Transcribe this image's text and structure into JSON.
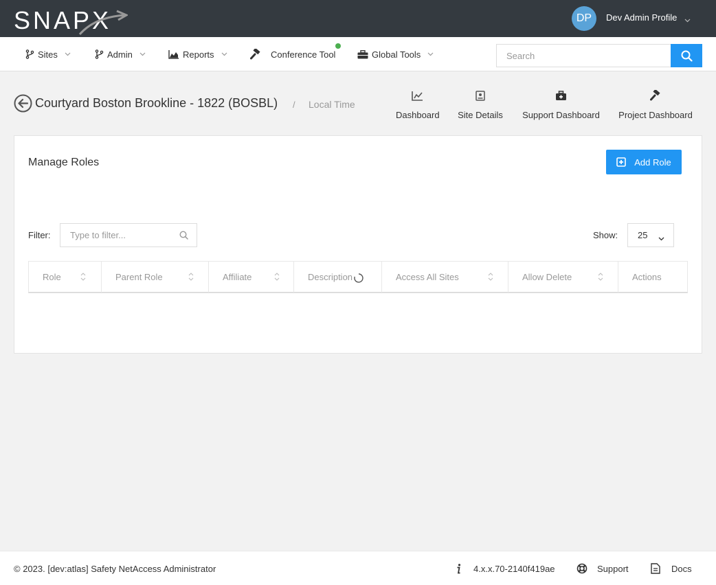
{
  "topbar": {
    "logo_text": "SNAPX",
    "avatar_initials": "DP",
    "profile_name": "Dev Admin Profile"
  },
  "nav": {
    "items": [
      {
        "label": "Sites",
        "icon": "branch-icon"
      },
      {
        "label": "Admin",
        "icon": "branch-icon"
      },
      {
        "label": "Reports",
        "icon": "area-chart-icon"
      },
      {
        "label": "Conference Tool",
        "icon": "gavel-icon"
      },
      {
        "label": "Global Tools",
        "icon": "toolbox-icon"
      }
    ],
    "search_placeholder": "Search"
  },
  "header": {
    "site_title": "Courtyard Boston Brookline - 1822 (BOSBL)",
    "separator": "/",
    "local_time": "Local Time",
    "links": [
      {
        "label": "Dashboard",
        "icon": "line-chart-icon"
      },
      {
        "label": "Site Details",
        "icon": "address-card-icon"
      },
      {
        "label": "Support Dashboard",
        "icon": "medkit-icon"
      },
      {
        "label": "Project Dashboard",
        "icon": "gavel-icon"
      }
    ]
  },
  "card": {
    "title": "Manage Roles",
    "add_button": "Add Role",
    "filter_label": "Filter:",
    "filter_placeholder": "Type to filter...",
    "show_label": "Show:",
    "show_value": "25",
    "columns": [
      "Role",
      "Parent Role",
      "Affiliate",
      "Description",
      "Access All Sites",
      "Allow Delete",
      "Actions"
    ]
  },
  "footer": {
    "copyright": "© 2023. [dev:atlas] Safety NetAccess Administrator",
    "version": "4.x.x.70-2140f419ae",
    "support": "Support",
    "docs": "Docs"
  },
  "colors": {
    "topbar": "#343a40",
    "accent": "#2196f3",
    "status_online": "#4caf50",
    "avatar": "#5aa3d8"
  }
}
